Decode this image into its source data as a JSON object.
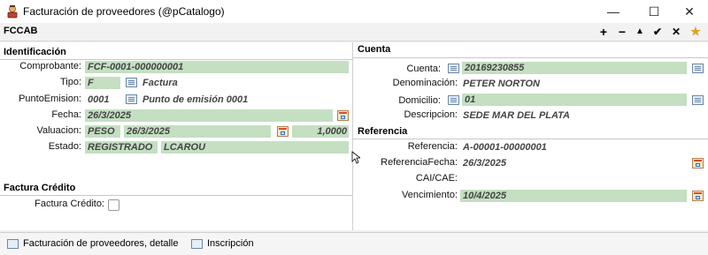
{
  "window": {
    "title": "Facturación de proveedores (@pCatalogo)",
    "minimize": "—",
    "maximize": "☐",
    "close": "✕"
  },
  "toolbar": {
    "form_code": "FCCAB",
    "add": "+",
    "remove": "−",
    "up": "▲",
    "confirm": "✔",
    "cancel": "✕",
    "extra": "★"
  },
  "identificacion": {
    "header": "Identificación",
    "comprobante_label": "Comprobante:",
    "comprobante_value": "FCF-0001-000000001",
    "tipo_label": "Tipo:",
    "tipo_code": "F",
    "tipo_desc": "Factura",
    "punto_label": "PuntoEmision:",
    "punto_code": "0001",
    "punto_desc": "Punto de emisión 0001",
    "fecha_label": "Fecha:",
    "fecha_value": "26/3/2025",
    "valuacion_label": "Valuacion:",
    "valuacion_moneda": "PESO",
    "valuacion_fecha": "26/3/2025",
    "valuacion_cotiz": "1,0000",
    "estado_label": "Estado:",
    "estado_value": "REGISTRADO",
    "estado_user": "LCAROU"
  },
  "factura_credito": {
    "header": "Factura Crédito",
    "label": "Factura Crédito:"
  },
  "cuenta": {
    "header": "Cuenta",
    "cuenta_label": "Cuenta:",
    "cuenta_value": "20169230855",
    "denominacion_label": "Denominación:",
    "denominacion_value": "PETER NORTON",
    "domicilio_label": "Domicilio:",
    "domicilio_value": "01",
    "descripcion_label": "Descripcion:",
    "descripcion_value": "SEDE MAR DEL PLATA"
  },
  "referencia": {
    "header": "Referencia",
    "referencia_label": "Referencia:",
    "referencia_value": "A-00001-00000001",
    "ref_fecha_label": "ReferenciaFecha:",
    "ref_fecha_value": "26/3/2025",
    "cai_label": "CAI/CAE:",
    "cai_value": "",
    "vencimiento_label": "Vencimiento:",
    "vencimiento_value": "10/4/2025"
  },
  "bottom_tabs": [
    {
      "label": "Facturación de proveedores, detalle"
    },
    {
      "label": "Inscripción"
    }
  ]
}
